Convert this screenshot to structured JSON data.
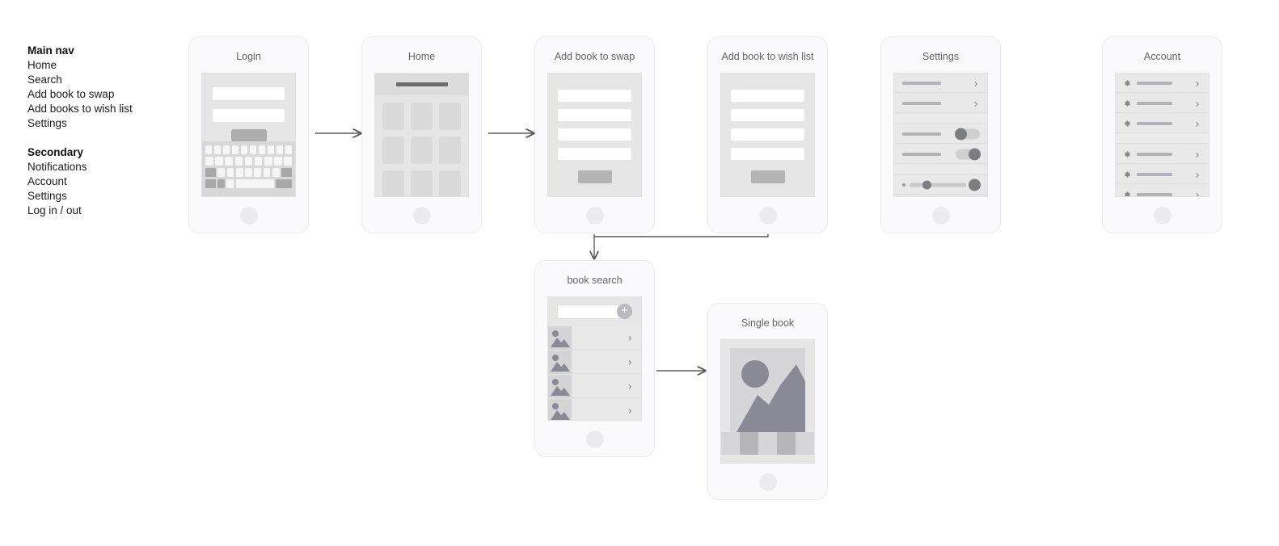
{
  "nav": {
    "groups": [
      {
        "heading": "Main nav",
        "items": [
          "Home",
          "Search",
          "Add book to swap",
          "Add books to wish list",
          "Settings"
        ]
      },
      {
        "heading": "Secondary",
        "items": [
          "Notifications",
          "Account",
          "Settings",
          "Log in / out"
        ]
      }
    ]
  },
  "screens": {
    "login": {
      "title": "Login",
      "fields": [
        "username-field",
        "password-field"
      ],
      "button": "submit-button",
      "keyboard_rows": [
        10,
        9,
        9,
        5
      ]
    },
    "home": {
      "title": "Home",
      "header_bar": "title-bar",
      "tiles": 9
    },
    "add_swap": {
      "title": "Add book to swap",
      "fields": 4,
      "button": "submit-button"
    },
    "add_wishlist": {
      "title": "Add book to wish list",
      "fields": 4,
      "button": "submit-button"
    },
    "settings": {
      "title": "Settings",
      "rows": [
        {
          "type": "chevron"
        },
        {
          "type": "chevron"
        },
        {
          "type": "gap"
        },
        {
          "type": "toggle",
          "state": "off"
        },
        {
          "type": "toggle",
          "state": "on"
        },
        {
          "type": "gap"
        },
        {
          "type": "slider",
          "value": "25"
        }
      ]
    },
    "account": {
      "title": "Account",
      "rows": [
        {
          "type": "gear-chevron"
        },
        {
          "type": "gear-chevron"
        },
        {
          "type": "gear-chevron"
        },
        {
          "type": "gap"
        },
        {
          "type": "gear-chevron"
        },
        {
          "type": "gear-chevron"
        },
        {
          "type": "gear-chevron"
        }
      ]
    },
    "book_search": {
      "title": "book search",
      "search_placeholder": "",
      "add_label": "+",
      "results": 4
    },
    "single_book": {
      "title": "Single book",
      "photo": "image-placeholder",
      "strip_segments": [
        "light",
        "dark",
        "light",
        "dark",
        "light"
      ]
    }
  },
  "icons": {
    "chevron": "›",
    "gear": "gear-icon",
    "plus": "+"
  },
  "colors": {
    "page_background": "#ffffff",
    "phone_frame": "#fafafc",
    "phone_border": "#ececed",
    "screen_background": "#e6e6e6",
    "title_text": "#646464",
    "nav_text": "#1a1a1a",
    "connector": "#5a5a5a",
    "accent_dark": "#7c7c83"
  },
  "flow": {
    "edges": [
      {
        "from": "Login",
        "to": "Home"
      },
      {
        "from": "Home",
        "to": "Add book to swap"
      },
      {
        "from": "Add book to swap",
        "to": "book search"
      },
      {
        "from": "Add book to wish list",
        "to": "book search"
      },
      {
        "from": "book search",
        "to": "Single book"
      }
    ]
  }
}
